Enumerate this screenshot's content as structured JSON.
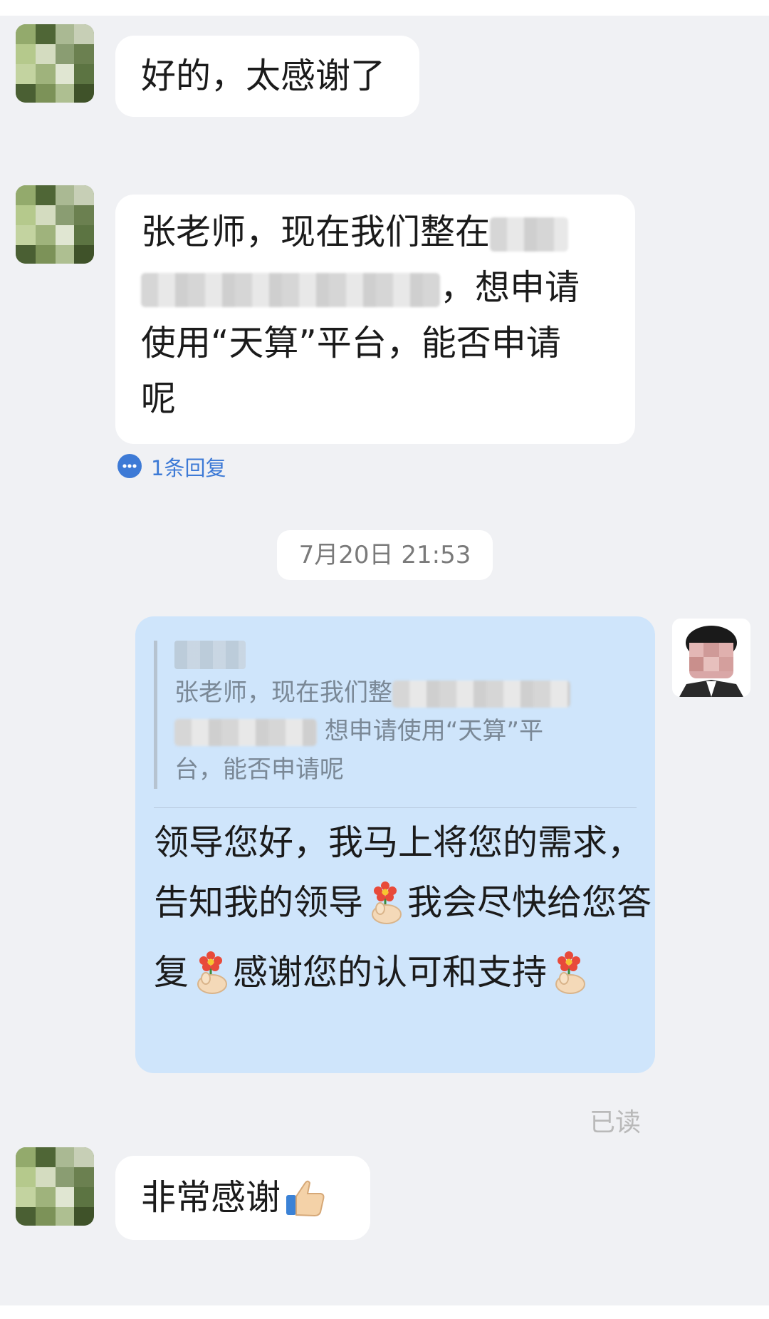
{
  "messages": [
    {
      "from": "other",
      "text": "好的，太感谢了"
    },
    {
      "from": "other",
      "line1": "张老师，现在我们整在",
      "line2": "，想申请",
      "line3": "使用“天算”平台，能否申请",
      "line4": "呢",
      "reply_count": "1条回复"
    },
    {
      "type": "timestamp",
      "text": "7月20日 21:53"
    },
    {
      "from": "self",
      "quote": {
        "line1": "张老师，现在我们整",
        "line2": "想申请使用“天算”平",
        "line3": "台，能否申请呢"
      },
      "reply_part1": "领导您好，我马上将您的需求，告知我的领导",
      "reply_part2": "我会尽快给您答复",
      "reply_part3": "感谢您的认可和支持",
      "emoji": "flower-hand-emoji",
      "status": "已读"
    },
    {
      "from": "other",
      "text": "非常感谢",
      "emoji": "thumbs-up-emoji"
    }
  ],
  "colors": {
    "background": "#f0f1f4",
    "bubble_other": "#ffffff",
    "bubble_self": "#cfe5fb",
    "link_blue": "#3d7ad6",
    "read_gray": "#b9b9b9"
  }
}
